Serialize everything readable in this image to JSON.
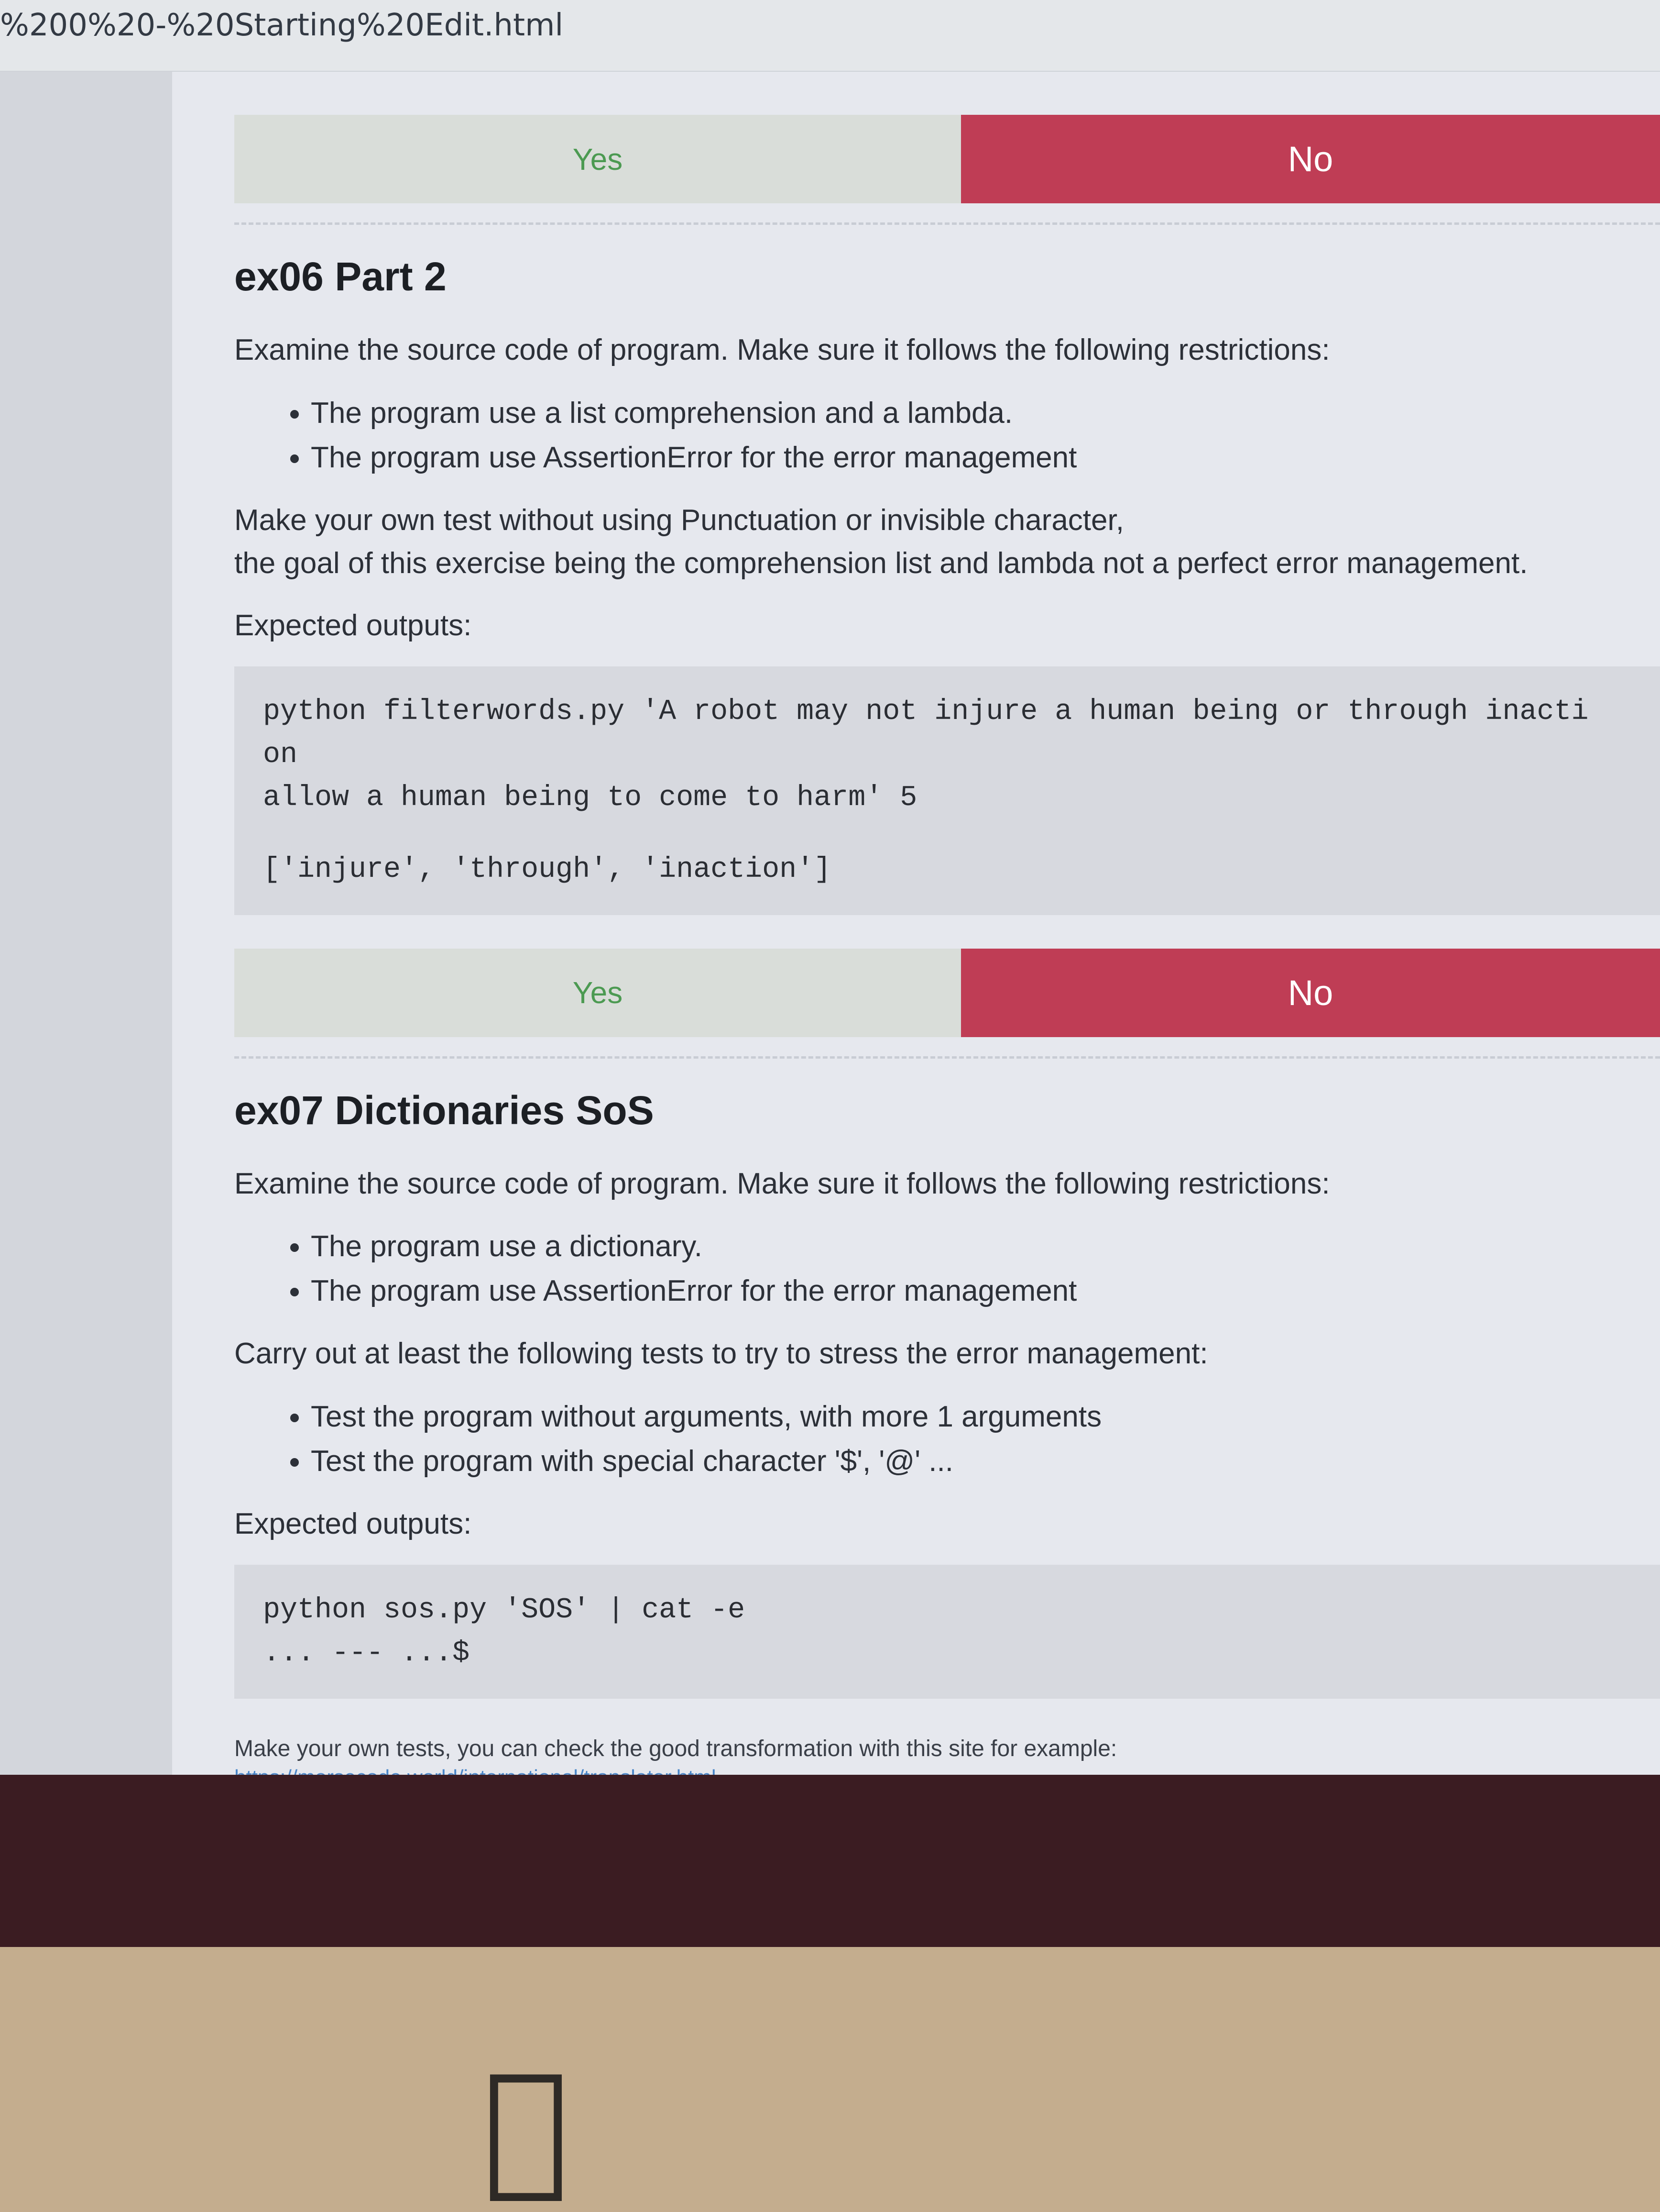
{
  "address_bar": {
    "url": "%200%20-%20Starting%20Edit.html"
  },
  "vote_top": {
    "yes": "Yes",
    "no": "No"
  },
  "ex06": {
    "title": "ex06 Part 2",
    "intro": "Examine the source code of program. Make sure it follows the following restrictions:",
    "restrictions": [
      "The program use a list comprehension and a lambda.",
      "The program use AssertionError for the error management"
    ],
    "note_line1": "Make your own test without using Punctuation or invisible character,",
    "note_line2": "the goal of this exercise being the comprehension list and lambda not a perfect error management.",
    "expected_label": "Expected outputs:",
    "code_lines": [
      "python filterwords.py 'A robot may not injure a human being or through inacti",
      "on",
      "allow a human being to come to harm' 5"
    ],
    "output_line": "['injure', 'through', 'inaction']"
  },
  "vote_mid": {
    "yes": "Yes",
    "no": "No"
  },
  "ex07": {
    "title": "ex07 Dictionaries SoS",
    "intro": "Examine the source code of program. Make sure it follows the following restrictions:",
    "restrictions": [
      "The program use a dictionary.",
      "The program use AssertionError for the error management"
    ],
    "tests_intro": "Carry out at least the following tests to try to stress the error management:",
    "tests": [
      "Test the program without arguments, with more 1 arguments",
      "Test the program with special character '$', '@' ..."
    ],
    "expected_label": "Expected outputs:",
    "code_lines": [
      "python sos.py 'SOS' | cat -e",
      "... --- ...$"
    ],
    "note": "Make your own tests, you can check the good transformation with this site for example:",
    "link": "https://morsecode.world/international/translator.html"
  }
}
